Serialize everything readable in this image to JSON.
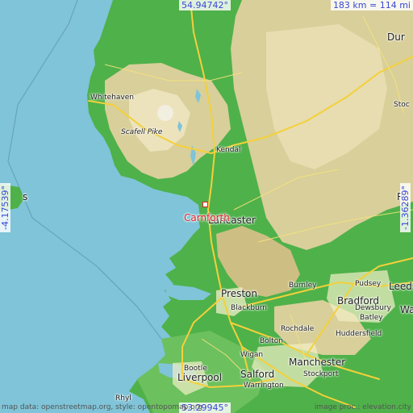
{
  "map": {
    "target": "Carnforth",
    "coords": {
      "top": "54.94742°",
      "bottom": "53.29945°",
      "left": "-4.17539°",
      "right": "-1.36289°"
    },
    "scale": "183 km = 114 mi",
    "credits": {
      "left": "map data: openstreetmap.org, style: opentopomap.org",
      "right": "image proc.: elevation.city"
    },
    "places": {
      "whitehaven": "Whitehaven",
      "scafell": "Scafell Pike",
      "kendal": "Kendal",
      "lancaster": "Lancaster",
      "preston": "Preston",
      "blackburn": "Blackburn",
      "burnley": "Burnley",
      "bradford": "Bradford",
      "pudsey": "Pudsey",
      "leeds": "Leeds",
      "dewsbury": "Dewsbury",
      "batley": "Batley",
      "wakefield": "Wa",
      "rochdale": "Rochdale",
      "huddersfield": "Huddersfield",
      "bolton": "Bolton",
      "wigan": "Wigan",
      "manchester": "Manchester",
      "salford": "Salford",
      "stockport": "Stockport",
      "liverpool": "Liverpool",
      "bootle": "Bootle",
      "warrington": "Warrington",
      "rhyl": "Rhyl",
      "durham": "Dur",
      "stockton": "Stoc",
      "ripon": "R",
      "iom": "s"
    },
    "colors": {
      "sea": "#7fc4d8",
      "lowland": "#4fb14a",
      "upland": "#d8cf9a",
      "peak": "#f2eee0",
      "road": "#f4d03a",
      "target": "#e0202a",
      "coord": "#3a47d6"
    }
  }
}
